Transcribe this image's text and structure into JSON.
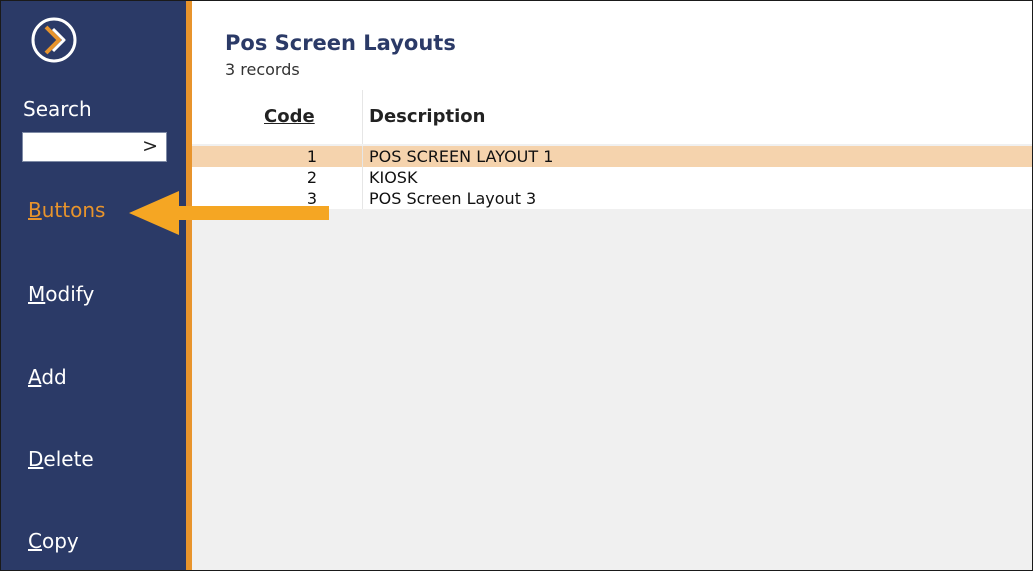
{
  "sidebar": {
    "search_label": "Search",
    "search_value": "",
    "search_go": ">",
    "items": [
      {
        "accel": "B",
        "rest": "uttons",
        "active": true
      },
      {
        "accel": "M",
        "rest": "odify",
        "active": false
      },
      {
        "accel": "A",
        "rest": "dd",
        "active": false
      },
      {
        "accel": "D",
        "rest": "elete",
        "active": false
      },
      {
        "accel": "C",
        "rest": "opy",
        "active": false
      }
    ]
  },
  "header": {
    "title": "Pos Screen Layouts",
    "subtitle": "3 records"
  },
  "table": {
    "columns": {
      "code": "Code",
      "description": "Description"
    },
    "rows": [
      {
        "code": "1",
        "description": "POS SCREEN LAYOUT 1",
        "selected": true
      },
      {
        "code": "2",
        "description": "KIOSK",
        "selected": false
      },
      {
        "code": "3",
        "description": "POS Screen Layout 3",
        "selected": false
      }
    ]
  },
  "colors": {
    "sidebar": "#2b3a67",
    "accent": "#e8942c",
    "selection": "#f5d3ad"
  },
  "icons": {
    "logo": "chevron-circle-logo-icon",
    "annotation": "arrow-left-icon"
  }
}
